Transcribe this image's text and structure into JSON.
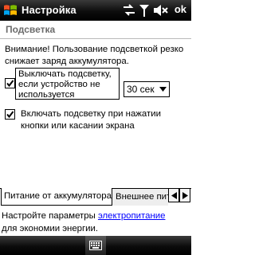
{
  "titlebar": {
    "title": "Настройка",
    "ok_label": "ok",
    "icons": [
      "windows-start-icon",
      "connectivity-icon",
      "signal-icon",
      "volume-muted-icon"
    ]
  },
  "page": {
    "title": "Подсветка",
    "warning": "Внимание! Пользование подсветкой резко снижает заряд аккумулятора."
  },
  "options": {
    "dim_checkbox": {
      "label": "Выключать подсветку, если устройство не используется",
      "checked": true
    },
    "timeout": {
      "value": "30 сек"
    },
    "wake_checkbox": {
      "label": "Включать подсветку при нажатии кнопки или касании экрана",
      "checked": true
    }
  },
  "tabs": {
    "active": "Питание от аккумулятора",
    "inactive": "Внешнее пит"
  },
  "footer": {
    "before_link": "Настройте параметры ",
    "link": "электропитание",
    "after_link": "для экономии энергии."
  },
  "colors": {
    "bar": "#000000",
    "link": "#0000ff",
    "section_title": "#6b6b6b"
  }
}
